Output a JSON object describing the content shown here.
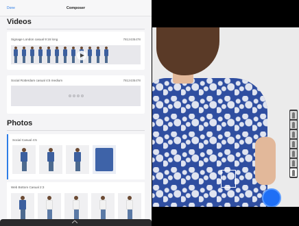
{
  "navbar": {
    "done_label": "Done",
    "title": "Composer"
  },
  "videos": {
    "section_title": "Videos",
    "items": [
      {
        "title": "Signage London casual 9:16 long",
        "id": "7812435478",
        "frames": 12
      },
      {
        "title": "Social Rotterdam casual 4:5 medium",
        "id": "7812435478",
        "loading_dots": 4
      }
    ]
  },
  "photos": {
    "section_title": "Photos",
    "groups": [
      {
        "title": "Social Casual 4:5",
        "selected": true,
        "thumbs": [
          "person",
          "person",
          "person",
          "closeup"
        ]
      },
      {
        "title": "Web Bottom Casual 2:3",
        "selected": false,
        "thumbs": [
          "person",
          "jeans",
          "jeans",
          "jeans",
          "jeans"
        ]
      }
    ]
  },
  "camera": {
    "pose_count": 7,
    "selected_pose": 6
  },
  "colors": {
    "accent": "#2c7ce6",
    "shutter": "#1f6ff5",
    "dress": "#2f4ea0"
  }
}
